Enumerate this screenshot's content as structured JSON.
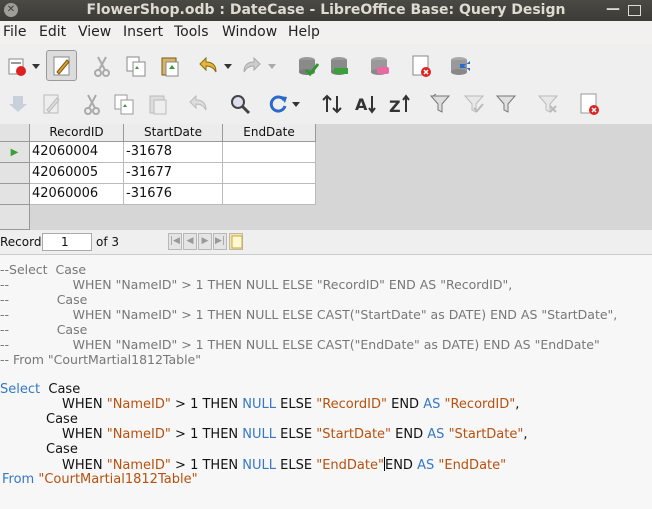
{
  "window": {
    "title": "FlowerShop.odb : DateCase - LibreOffice Base: Query Design",
    "close_glyph": "✕",
    "minimize_glyph": "—"
  },
  "menu": [
    "File",
    "Edit",
    "View",
    "Insert",
    "Tools",
    "Window",
    "Help"
  ],
  "toolbar1": [
    "new-document-icon",
    "dropdown-arrow-icon",
    "edit-mode-icon",
    "cut-icon",
    "copy-icon",
    "paste-icon",
    "undo-icon",
    "dropdown-arrow-icon",
    "redo-icon",
    "dropdown-arrow-icon",
    "run-query-icon",
    "clear-query-icon",
    "design-view-icon",
    "add-tables-icon",
    "sort-icon"
  ],
  "toolbar2": [
    "save-record-icon",
    "edit-data-icon",
    "cut-icon",
    "copy-icon",
    "paste-icon",
    "undo-icon",
    "find-record-icon",
    "refresh-icon",
    "sort-icon",
    "sort-ascending-icon",
    "sort-descending-icon",
    "autofilter-icon",
    "apply-filter-icon",
    "standard-filter-icon",
    "reset-filter-icon",
    "delete-record-icon"
  ],
  "grid": {
    "columns": [
      "RecordID",
      "StartDate",
      "EndDate"
    ],
    "rows": [
      [
        "42060004",
        "-31678",
        ""
      ],
      [
        "42060005",
        "-31677",
        ""
      ],
      [
        "42060006",
        "-31676",
        ""
      ]
    ],
    "current_row_marker": "▶"
  },
  "navigator": {
    "label": "Record",
    "value": "1",
    "of_text": "of 3"
  },
  "sql": {
    "comment_lines": [
      "--Select  Case",
      "--                WHEN \"NameID\" > 1 THEN NULL ELSE \"RecordID\" END AS \"RecordID\",",
      "--            Case",
      "--                WHEN \"NameID\" > 1 THEN NULL ELSE CAST(\"StartDate\" as DATE) END AS \"StartDate\",",
      "--            Case",
      "--                WHEN \"NameID\" > 1 THEN NULL ELSE CAST(\"EndDate\" as DATE) END AS \"EndDate\"",
      "-- From \"CourtMartial1812Table\""
    ],
    "kw_select": "Select",
    "kw_case": "Case",
    "kw_when": "WHEN",
    "kw_then": "THEN",
    "kw_null": "NULL",
    "kw_else": "ELSE",
    "kw_end": "END",
    "kw_as": "AS",
    "kw_from": "From",
    "str_nameid": "\"NameID\"",
    "op_gt": ">",
    "num_one": "1",
    "str_recordid": "\"RecordID\"",
    "str_startdate": "\"StartDate\"",
    "str_enddate": "\"EndDate\"",
    "str_table": "\"CourtMartial1812Table\"",
    "comma": ","
  }
}
